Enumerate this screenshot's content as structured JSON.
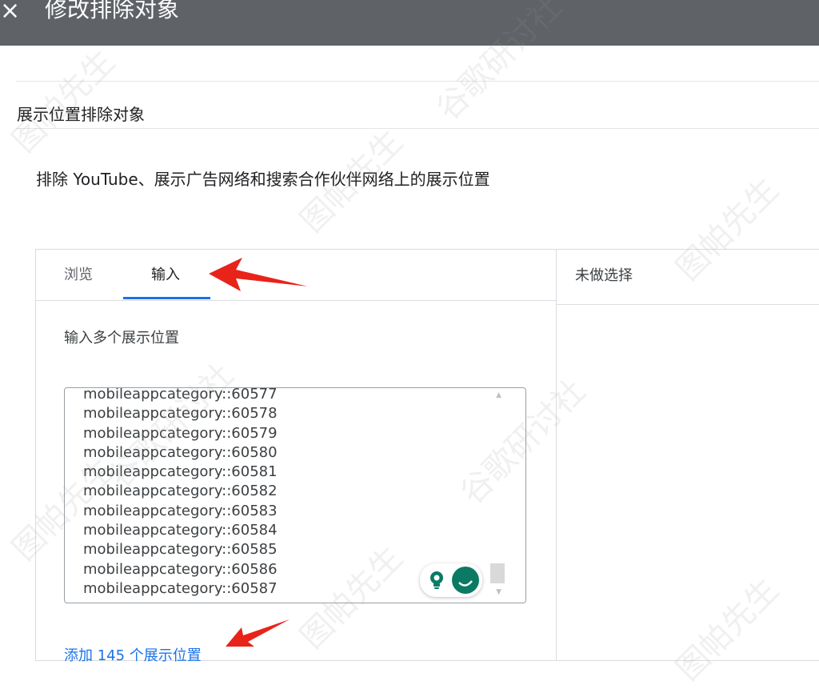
{
  "header": {
    "close_icon": "×",
    "title": "修改排除对象"
  },
  "section": {
    "title": "展示位置排除对象",
    "subtitle": "排除 YouTube、展示广告网络和搜索合作伙伴网络上的展示位置"
  },
  "tabs": [
    {
      "label": "浏览",
      "active": false
    },
    {
      "label": "输入",
      "active": true
    }
  ],
  "input": {
    "label": "输入多个展示位置",
    "lines": [
      "mobileappcategory::60577",
      "mobileappcategory::60578",
      "mobileappcategory::60579",
      "mobileappcategory::60580",
      "mobileappcategory::60581",
      "mobileappcategory::60582",
      "mobileappcategory::60583",
      "mobileappcategory::60584",
      "mobileappcategory::60585",
      "mobileappcategory::60586",
      "mobileappcategory::60587"
    ],
    "add_link": "添加 145 个展示位置"
  },
  "selection": {
    "title": "未做选择"
  },
  "watermarks": [
    "图帕先生",
    "谷歌研讨社"
  ],
  "colors": {
    "topbar": "#5f6368",
    "accent": "#1a73e8",
    "annotation_arrow": "#e8231a",
    "extension": "#0b7a64"
  }
}
